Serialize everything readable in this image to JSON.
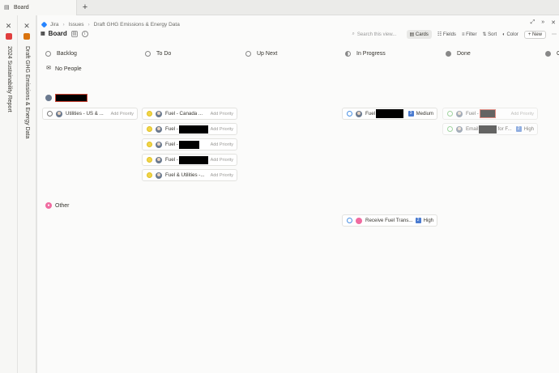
{
  "tabbar": {
    "tab_label": "Board",
    "new_tab": "+"
  },
  "side1": {
    "close": "✕",
    "label": "2024 Sustainability Report",
    "icon_color": "#e03e3e"
  },
  "side2": {
    "close": "✕",
    "label": "Draft GHG Emissions & Energy Data",
    "icon_color": "#d9730d"
  },
  "breadcrumbs": {
    "root": "Jira",
    "issues": "Issues",
    "page": "Draft GHG Emissions & Energy Data"
  },
  "board": {
    "title": "Board"
  },
  "toolbar": {
    "search_placeholder": "Search this view...",
    "cards": "Cards",
    "fields": "Fields",
    "filter": "Filter",
    "sort": "Sort",
    "color": "Color",
    "new": "+ New"
  },
  "statuses": [
    "Backlog",
    "To Do",
    "Up Next",
    "In Progress",
    "Done",
    "Ca"
  ],
  "no_people": "No People",
  "group_other": "Other",
  "cards": {
    "backlog1": {
      "title": "Utilities - US & ...",
      "priority": "Add Priority"
    },
    "todo1": {
      "title": "Fuel - Canada ...",
      "priority": "Add Priority"
    },
    "todo2": {
      "title": "Fuel -",
      "priority": "Add Priority"
    },
    "todo3": {
      "title": "Fuel -",
      "priority": "Add Priority"
    },
    "todo4": {
      "title": "Fuel -",
      "priority": "Add Priority"
    },
    "todo5": {
      "title": "Fuel & Utilities -...",
      "priority": "Add Priority"
    },
    "prog1": {
      "title": "Fuel",
      "priority_num": "3",
      "priority": "Medium"
    },
    "done1": {
      "title": "Fuel -",
      "priority": "Add Priority"
    },
    "done2": {
      "title": "Email",
      "title_tail": "for F...",
      "priority_num": "2",
      "priority": "High"
    },
    "prog2": {
      "title": "Receive Fuel Trans...",
      "priority_num": "2",
      "priority": "High"
    }
  },
  "icons": {
    "board": "board-icon",
    "search": "search-icon"
  }
}
